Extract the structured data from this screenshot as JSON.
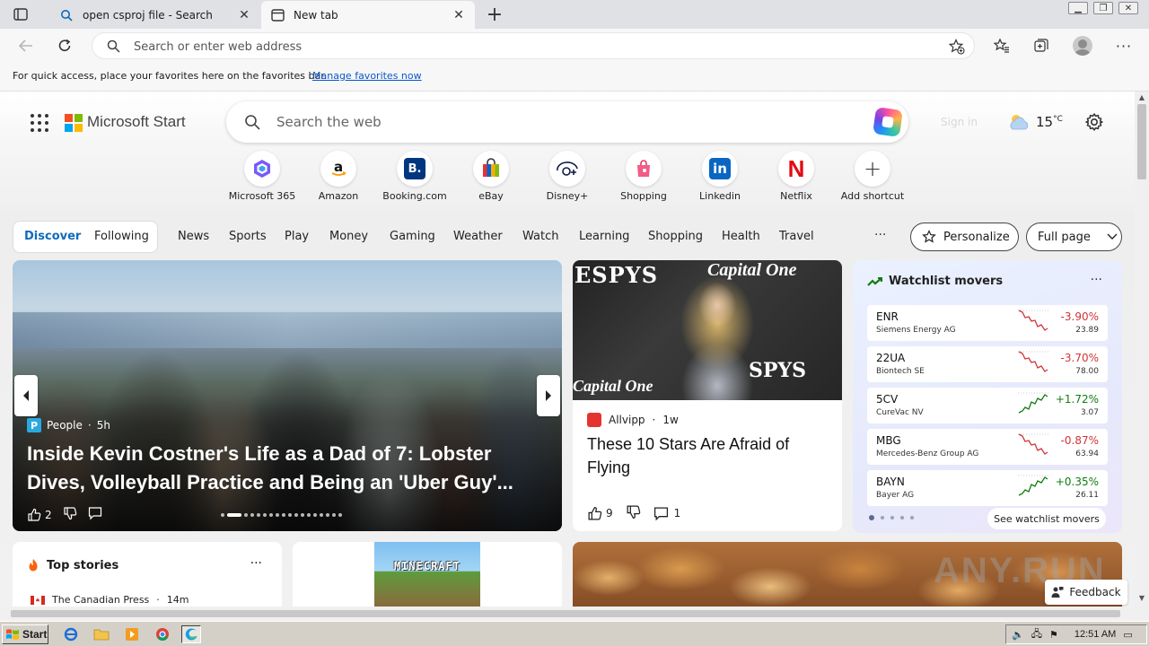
{
  "browser": {
    "tabs": [
      {
        "title": "open csproj file - Search",
        "active": false
      },
      {
        "title": "New tab",
        "active": true
      }
    ],
    "address": {
      "placeholder": "Search or enter web address",
      "value": ""
    },
    "favorites_bar": {
      "message": "For quick access, place your favorites here on the favorites bar.",
      "link": "Manage favorites now"
    }
  },
  "header": {
    "brand": "Microsoft Start",
    "search_placeholder": "Search the web",
    "signin": "Sign in",
    "weather": {
      "temp": "15",
      "unit": "°C"
    }
  },
  "shortcuts": [
    {
      "label": "Microsoft 365",
      "icon": "m365-icon"
    },
    {
      "label": "Amazon",
      "icon": "amazon-icon"
    },
    {
      "label": "Booking.com",
      "icon": "booking-icon"
    },
    {
      "label": "eBay",
      "icon": "ebay-icon"
    },
    {
      "label": "Disney+",
      "icon": "disney-icon"
    },
    {
      "label": "Shopping",
      "icon": "shopping-icon"
    },
    {
      "label": "Linkedin",
      "icon": "linkedin-icon"
    },
    {
      "label": "Netflix",
      "icon": "netflix-icon"
    },
    {
      "label": "Add shortcut",
      "icon": "plus-icon"
    }
  ],
  "feed": {
    "segments": [
      "Discover",
      "Following"
    ],
    "categories": [
      "News",
      "Sports",
      "Play",
      "Money",
      "Gaming",
      "Weather",
      "Watch",
      "Learning",
      "Shopping",
      "Health",
      "Travel"
    ],
    "more": "···",
    "personalize": "Personalize",
    "layout": "Full page"
  },
  "hero": {
    "source": "People",
    "age": "5h",
    "headline": "Inside Kevin Costner's Life as a Dad of 7: Lobster Dives, Volleyball Practice and Being an 'Uber Guy'...",
    "likes": "2"
  },
  "article": {
    "img_text": [
      "ESPYS",
      "Capital One",
      "Capital One",
      "SPYS"
    ],
    "source": "Allvipp",
    "age": "1w",
    "title": "These 10 Stars Are Afraid of Flying",
    "likes": "9",
    "comments": "1"
  },
  "watchlist": {
    "title": "Watchlist movers",
    "stocks": [
      {
        "ticker": "ENR",
        "name": "Siemens Energy AG",
        "change": "-3.90%",
        "price": "23.89",
        "direction": "down"
      },
      {
        "ticker": "22UA",
        "name": "Biontech SE",
        "change": "-3.70%",
        "price": "78.00",
        "direction": "down"
      },
      {
        "ticker": "5CV",
        "name": "CureVac NV",
        "change": "+1.72%",
        "price": "3.07",
        "direction": "up"
      },
      {
        "ticker": "MBG",
        "name": "Mercedes-Benz Group AG",
        "change": "-0.87%",
        "price": "63.94",
        "direction": "down"
      },
      {
        "ticker": "BAYN",
        "name": "Bayer AG",
        "change": "+0.35%",
        "price": "26.11",
        "direction": "up"
      }
    ],
    "link": "See watchlist movers",
    "colors": {
      "down": "#d13438",
      "up": "#107c10"
    }
  },
  "bottom": {
    "top_stories": "Top stories",
    "top_source": "The Canadian Press",
    "top_age": "14m",
    "minecraft": "MINECRAFT",
    "feedback": "Feedback"
  },
  "taskbar": {
    "start": "Start",
    "clock": "12:51 AM"
  },
  "watermark": "ANY.RUN"
}
